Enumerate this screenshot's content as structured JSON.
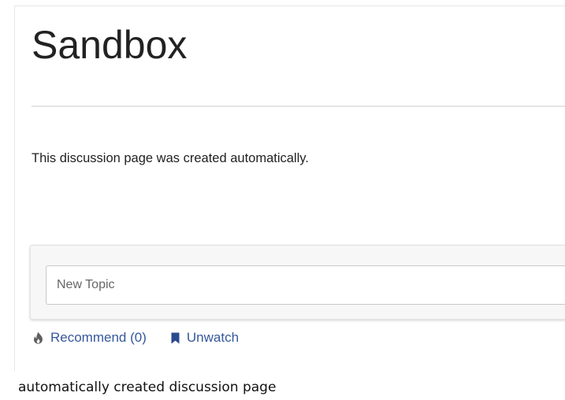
{
  "page": {
    "title": "Sandbox",
    "intro": "This discussion page was created automatically."
  },
  "new_topic": {
    "placeholder": "New Topic"
  },
  "actions": {
    "recommend": {
      "label": "Recommend",
      "count_text": "(0)",
      "icon": "flame-icon"
    },
    "unwatch": {
      "label": "Unwatch",
      "icon": "bookmark-icon"
    }
  },
  "caption": "automatically created discussion page",
  "colors": {
    "link": "#36589c",
    "text": "#222222",
    "panel": "#f7f7f7",
    "divider": "#e5e5e5"
  }
}
